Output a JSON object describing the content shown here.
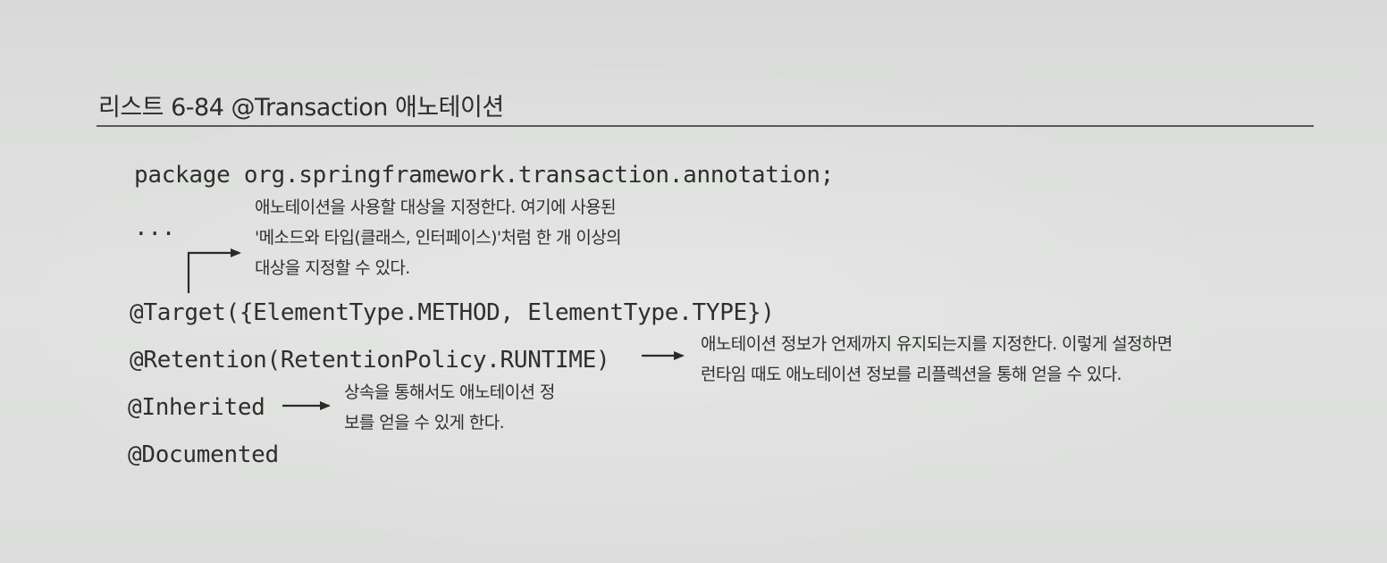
{
  "listing": {
    "title": "리스트 6-84 @Transaction 애노테이션"
  },
  "code": {
    "package_line": "package org.springframework.transaction.annotation;",
    "ellipsis": "...",
    "target_line": "@Target({ElementType.METHOD, ElementType.TYPE})",
    "retention_line": "@Retention(RetentionPolicy.RUNTIME)",
    "inherited_line": "@Inherited",
    "documented_line": "@Documented"
  },
  "annotations": {
    "target_note": [
      "애노테이션을 사용할 대상을 지정한다. 여기에 사용된",
      "'메소드와 타입(클래스, 인터페이스)'처럼 한 개 이상의",
      "대상을 지정할 수 있다."
    ],
    "retention_note": [
      "애노테이션 정보가 언제까지 유지되는지를 지정한다. 이렇게 설정하면",
      "런타임 때도 애노테이션 정보를 리플렉션을 통해 얻을 수 있다."
    ],
    "inherited_note": [
      "상속을 통해서도 애노테이션 정",
      "보를 얻을 수 있게 한다."
    ]
  }
}
